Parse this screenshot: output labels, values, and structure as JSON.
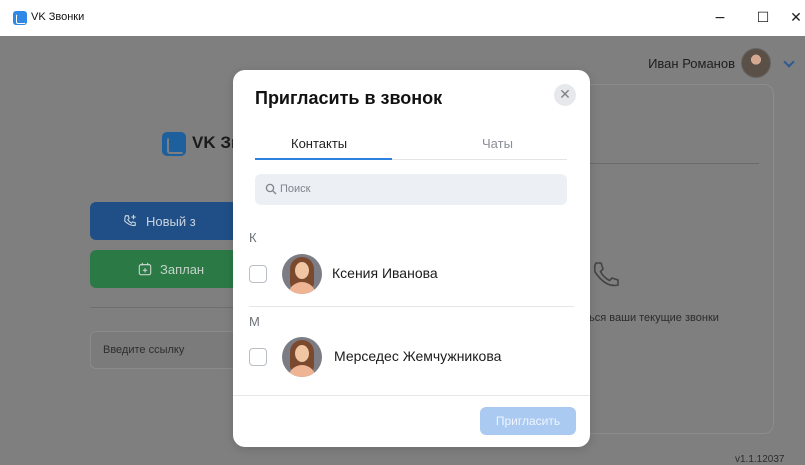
{
  "window": {
    "title": "VK Звонки",
    "controls": {
      "minimize": "−",
      "maximize": "☐",
      "close": "✕"
    }
  },
  "user": {
    "name": "Иван Романов"
  },
  "background": {
    "brand_text": "VK Зв",
    "new_call_label": "Новый з",
    "plan_label": "Заплан",
    "link_placeholder": "Введите ссылку",
    "current_calls_text": "ться ваши текущие звонки",
    "version": "v1.1.12037"
  },
  "modal": {
    "title": "Пригласить в звонок",
    "close_symbol": "✕",
    "tabs": [
      {
        "label": "Контакты",
        "active": true
      },
      {
        "label": "Чаты",
        "active": false
      }
    ],
    "search_placeholder": "Поиск",
    "sections": [
      {
        "letter": "К",
        "contacts": [
          {
            "name": "Ксения Иванова",
            "checked": false
          }
        ]
      },
      {
        "letter": "М",
        "contacts": [
          {
            "name": "Мерседес Жемчужникова",
            "checked": false
          }
        ]
      }
    ],
    "invite_label": "Пригласить"
  },
  "colors": {
    "accent": "#2d81e0",
    "invite_disabled": "#abcaf1",
    "overlay": "#7f7f7f"
  }
}
